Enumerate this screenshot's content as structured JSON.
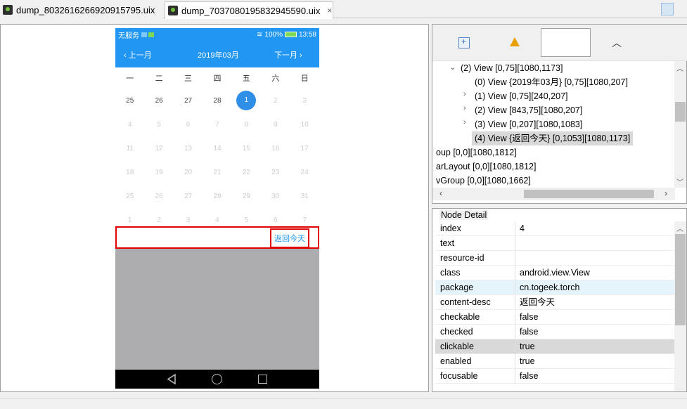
{
  "tabs": [
    {
      "label": "dump_8032616266920915795.uix"
    },
    {
      "label": "dump_7037080195832945590.uix",
      "close": "×"
    }
  ],
  "phone": {
    "status": {
      "carrier": "无服务",
      "battery": "100%",
      "time": "13:58"
    },
    "header": {
      "prev": "上一月",
      "title": "2019年03月",
      "next": "下一月"
    },
    "weekdays": [
      "一",
      "二",
      "三",
      "四",
      "五",
      "六",
      "日"
    ],
    "rows": [
      [
        "25",
        "26",
        "27",
        "28",
        "1",
        "2",
        "3"
      ],
      [
        "4",
        "5",
        "6",
        "7",
        "8",
        "9",
        "10"
      ],
      [
        "11",
        "12",
        "13",
        "14",
        "15",
        "16",
        "17"
      ],
      [
        "18",
        "19",
        "20",
        "21",
        "22",
        "23",
        "24"
      ],
      [
        "25",
        "26",
        "27",
        "28",
        "29",
        "30",
        "31"
      ],
      [
        "1",
        "2",
        "3",
        "4",
        "5",
        "6",
        "7"
      ]
    ],
    "today_button": "返回今天"
  },
  "tree": {
    "nodes": [
      {
        "text": "(2) View [0,75][1080,1173]"
      },
      {
        "text": "(0) View {2019年03月} [0,75][1080,207]"
      },
      {
        "text": "(1) View [0,75][240,207]"
      },
      {
        "text": "(2) View [843,75][1080,207]"
      },
      {
        "text": "(3) View [0,207][1080,1083]"
      },
      {
        "text": "(4) View {返回今天} [0,1053][1080,1173]"
      },
      {
        "text": "oup [0,0][1080,1812]"
      },
      {
        "text": "arLayout [0,0][1080,1812]"
      },
      {
        "text": "vGroup [0,0][1080,1662]"
      }
    ]
  },
  "detail": {
    "title": "Node Detail",
    "rows": [
      {
        "key": "index",
        "value": "4"
      },
      {
        "key": "text",
        "value": ""
      },
      {
        "key": "resource-id",
        "value": ""
      },
      {
        "key": "class",
        "value": "android.view.View"
      },
      {
        "key": "package",
        "value": "cn.togeek.torch"
      },
      {
        "key": "content-desc",
        "value": "返回今天"
      },
      {
        "key": "checkable",
        "value": "false"
      },
      {
        "key": "checked",
        "value": "false"
      },
      {
        "key": "clickable",
        "value": "true"
      },
      {
        "key": "enabled",
        "value": "true"
      },
      {
        "key": "focusable",
        "value": "false"
      }
    ]
  }
}
